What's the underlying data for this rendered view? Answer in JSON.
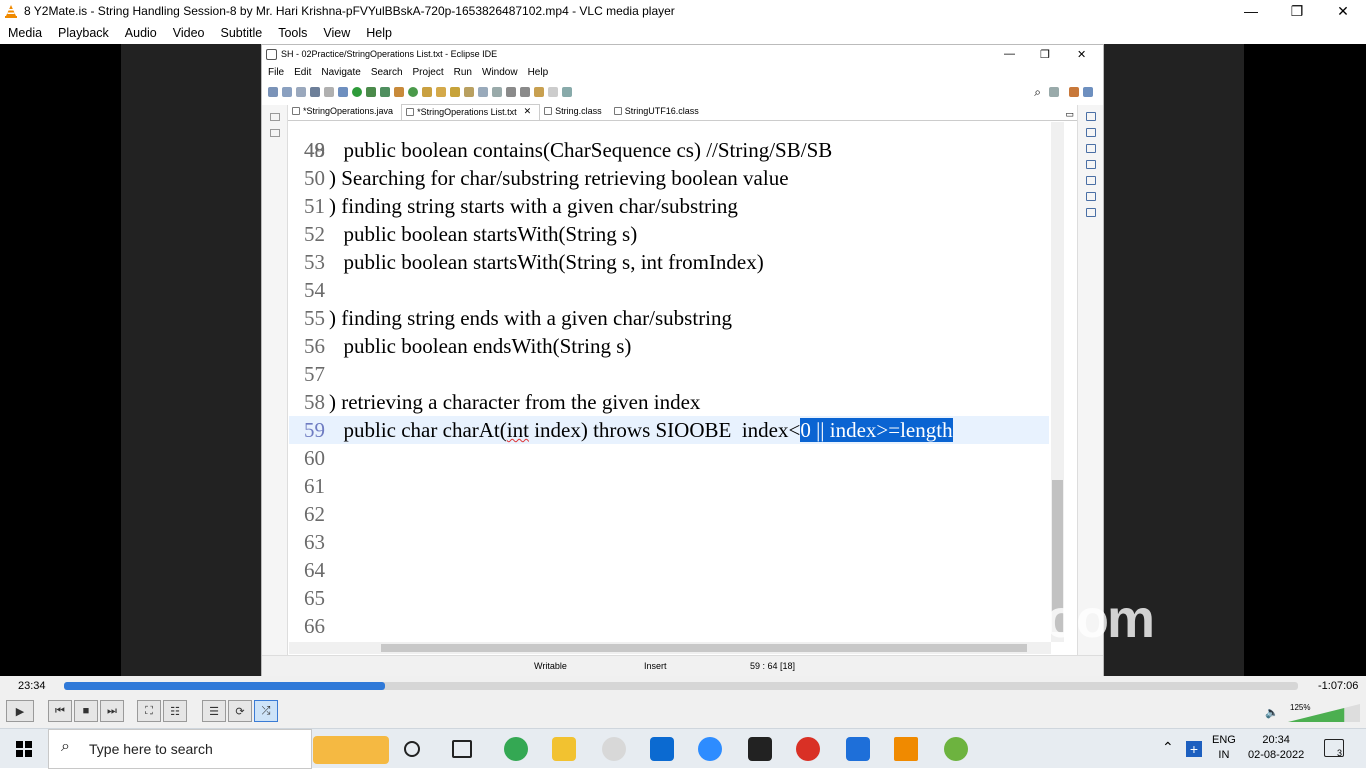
{
  "window": {
    "title": "8 Y2Mate.is - String Handling Session-8  by Mr. Hari Krishna-pFVYulBBskA-720p-1653826487102.mp4 - VLC media player",
    "minimize": "—",
    "maximize": "❐",
    "close": "✕"
  },
  "vlc_menu": [
    "Media",
    "Playback",
    "Audio",
    "Video",
    "Subtitle",
    "Tools",
    "View",
    "Help"
  ],
  "eclipse": {
    "title": "SH - 02Practice/StringOperations List.txt - Eclipse IDE",
    "menu": [
      "File",
      "Edit",
      "Navigate",
      "Search",
      "Project",
      "Run",
      "Window",
      "Help"
    ],
    "tabs": [
      {
        "label": "*StringOperations.java"
      },
      {
        "label": "*StringOperations List.txt",
        "close": "✕"
      },
      {
        "label": "String.class"
      },
      {
        "label": "StringUTF16.class"
      }
    ],
    "cut_line": ") Searching for char/substring retrieving boolean value",
    "lines": [
      {
        "num": "49",
        "code": "  public boolean contains(CharSequence cs) //String/SB/SB"
      },
      {
        "num": "50",
        "code": ""
      },
      {
        "num": "51",
        "code": ") finding string starts with a given char/substring"
      },
      {
        "num": "52",
        "code": "  public boolean startsWith(String s)"
      },
      {
        "num": "53",
        "code": "  public boolean startsWith(String s, int fromIndex)"
      },
      {
        "num": "54",
        "code": ""
      },
      {
        "num": "55",
        "code": ") finding string ends with a given char/substring"
      },
      {
        "num": "56",
        "code": "  public boolean endsWith(String s)"
      },
      {
        "num": "57",
        "code": ""
      },
      {
        "num": "58",
        "code": ") retrieving a character from the given index"
      },
      {
        "num": "59",
        "code_pre": "  public char charAt(",
        "code_int": "int",
        "code_mid": " index) throws SIOOBE  index<",
        "code_sel": "0 || index>=length"
      },
      {
        "num": "60",
        "code": ""
      },
      {
        "num": "61",
        "code": ""
      },
      {
        "num": "62",
        "code": ""
      },
      {
        "num": "63",
        "code": ""
      },
      {
        "num": "64",
        "code": ""
      },
      {
        "num": "65",
        "code": ""
      },
      {
        "num": "66",
        "code": ""
      }
    ],
    "status": {
      "mode": "Writable",
      "insert": "Insert",
      "position": "59 : 64 [18]"
    }
  },
  "watermark": "zoom",
  "player": {
    "time_current": "23:34",
    "time_remaining": "-1:07:06",
    "progress": 0.26,
    "volume": "125%",
    "volume_level": 1.25
  },
  "taskbar": {
    "search_placeholder": "Type here to search",
    "lang_top": "ENG",
    "lang_bottom": "IN",
    "time": "20:34",
    "date": "02-08-2022",
    "notifications": "3"
  },
  "colors": {
    "selection": "#0a64d2",
    "seek": "#2f79d8",
    "vlc_orange": "#f08a00"
  }
}
